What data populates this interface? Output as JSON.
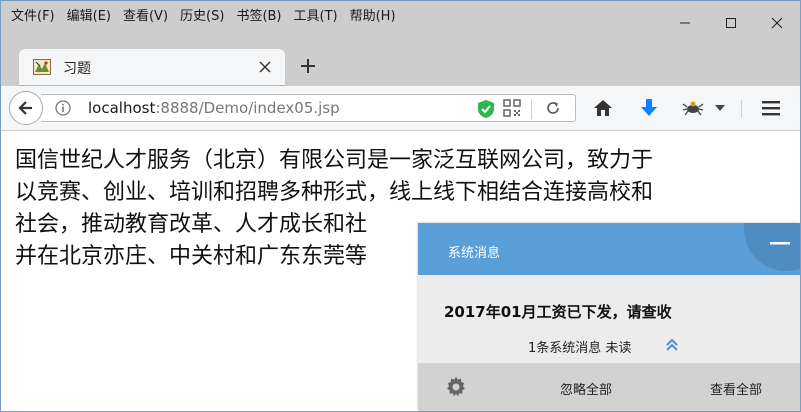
{
  "menubar": {
    "items": [
      "文件(F)",
      "编辑(E)",
      "查看(V)",
      "历史(S)",
      "书签(B)",
      "工具(T)",
      "帮助(H)"
    ]
  },
  "window_controls": {
    "icons": [
      "minimize-icon",
      "maximize-icon",
      "close-icon"
    ]
  },
  "tab": {
    "title": "习题",
    "close_icon": "close-icon",
    "new_tab_icon": "plus-icon"
  },
  "navbar": {
    "url_host": "localhost",
    "url_rest": ":8888/Demo/index05.jsp",
    "icons": [
      "back-arrow-icon",
      "info-icon",
      "shield-icon",
      "qr-code-icon",
      "reload-icon",
      "home-icon",
      "download-icon",
      "extension-icon",
      "dropdown-icon",
      "menu-icon"
    ],
    "accent": "#0a84ff",
    "shield_color": "#2eb84b"
  },
  "content": {
    "lines": [
      "国信世纪人才服务（北京）有限公司是一家泛互联网公司，致力于",
      "以竞赛、创业、培训和招聘多种形式，线上线下相结合连接高校和",
      "社会，推动教育改革、人才成长和社",
      "并在北京亦庄、中关村和广东东莞等"
    ]
  },
  "notification": {
    "header_title": "系统消息",
    "header_color": "#5b9fd8",
    "subject": "2017年01月工资已下发，请查收",
    "meta": "1条系统消息 未读",
    "footer": {
      "ignore_all": "忽略全部",
      "view_all": "查看全部"
    }
  }
}
